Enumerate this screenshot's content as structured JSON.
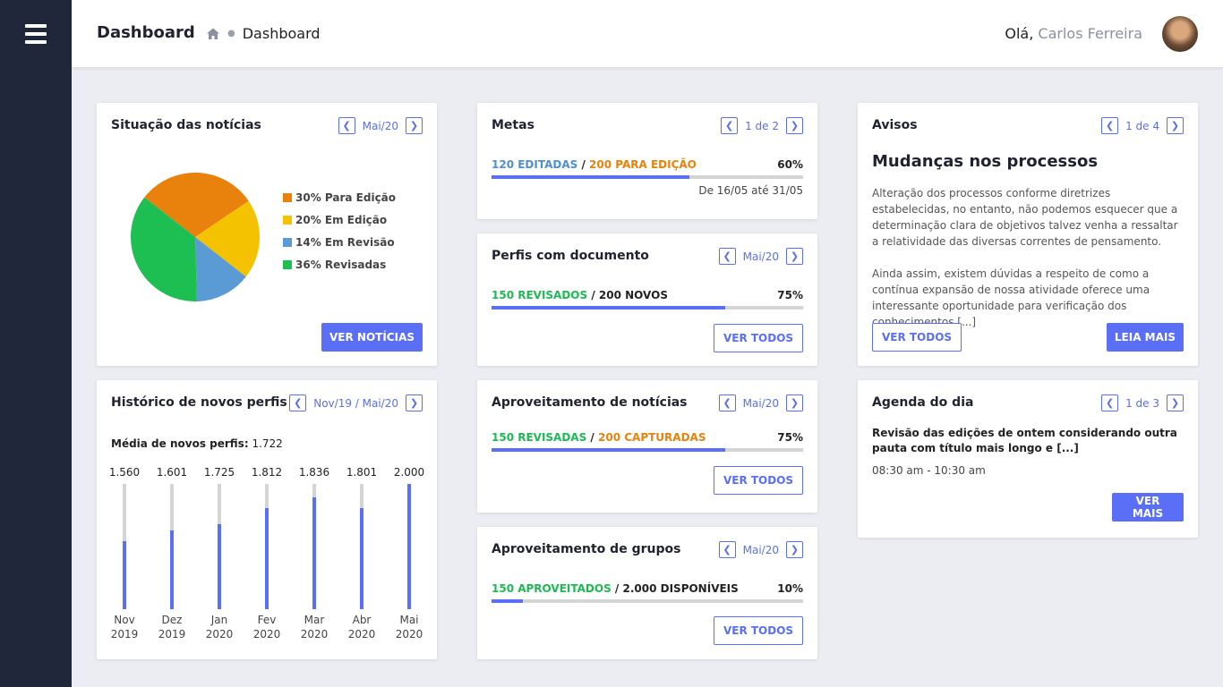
{
  "header": {
    "page_title": "Dashboard",
    "breadcrumb_current": "Dashboard",
    "greeting": "Olá,",
    "user_name": "Carlos Ferreira"
  },
  "news_status": {
    "title": "Situação das notícias",
    "pager_label": "Mai/20",
    "legend": [
      {
        "label": "30% Para Edição",
        "color": "#e8820c"
      },
      {
        "label": "20% Em Edição",
        "color": "#f5c200"
      },
      {
        "label": "14% Em Revisão",
        "color": "#5b9bd5"
      },
      {
        "label": "36% Revisadas",
        "color": "#1dbf52"
      }
    ],
    "button": "VER NOTÍCIAS"
  },
  "chart_data": [
    {
      "type": "pie",
      "title": "Situação das notícias",
      "labels": [
        "Para Edição",
        "Em Edição",
        "Em Revisão",
        "Revisadas"
      ],
      "values": [
        30,
        20,
        14,
        36
      ],
      "colors": [
        "#e8820c",
        "#f5c200",
        "#5b9bd5",
        "#1dbf52"
      ]
    },
    {
      "type": "bar",
      "title": "Histórico de novos perfis",
      "categories": [
        "Nov 2019",
        "Dez 2019",
        "Jan 2020",
        "Fev 2020",
        "Mar 2020",
        "Abr 2020",
        "Mai 2020"
      ],
      "values": [
        1560,
        1601,
        1725,
        1812,
        1836,
        1801,
        2000
      ],
      "fill_fraction": [
        0.54,
        0.63,
        0.68,
        0.81,
        0.89,
        0.81,
        1.0
      ]
    }
  ],
  "history": {
    "title": "Histórico de novos perfis",
    "pager_label": "Nov/19 / Mai/20",
    "avg_label": "Média de novos perfis:",
    "avg_value": "1.722",
    "bars": [
      {
        "value": "1.560",
        "month": "Nov",
        "year": "2019"
      },
      {
        "value": "1.601",
        "month": "Dez",
        "year": "2019"
      },
      {
        "value": "1.725",
        "month": "Jan",
        "year": "2020"
      },
      {
        "value": "1.812",
        "month": "Fev",
        "year": "2020"
      },
      {
        "value": "1.836",
        "month": "Mar",
        "year": "2020"
      },
      {
        "value": "1.801",
        "month": "Abr",
        "year": "2020"
      },
      {
        "value": "2.000",
        "month": "Mai",
        "year": "2020"
      }
    ]
  },
  "goals": {
    "title": "Metas",
    "pager_label": "1 de 2",
    "done": "120 EDITADAS",
    "sep": " / ",
    "pending": "200 PARA EDIÇÃO",
    "percent": "60%",
    "progress": 0.635,
    "date_range": "De 16/05 até 31/05"
  },
  "profiles_doc": {
    "title": "Perfis com documento",
    "pager_label": "Mai/20",
    "done": "150 REVISADOS",
    "sep": " / ",
    "total": "200 NOVOS",
    "percent": "75%",
    "progress": 0.75,
    "button": "VER TODOS"
  },
  "news_usage": {
    "title": "Aproveitamento de notícias",
    "pager_label": "Mai/20",
    "done": "150 REVISADAS",
    "sep": " / ",
    "captured": "200 CAPTURADAS",
    "percent": "75%",
    "progress": 0.75,
    "button": "VER TODOS"
  },
  "groups_usage": {
    "title": "Aproveitamento de grupos",
    "pager_label": "Mai/20",
    "done": "150 APROVEITADOS",
    "sep": " / ",
    "total": "2.000 DISPONÍVEIS",
    "percent": "10%",
    "progress": 0.1,
    "button": "VER TODOS"
  },
  "notices": {
    "title": "Avisos",
    "pager_label": "1 de 4",
    "heading": "Mudanças nos processos",
    "paragraph1": "Alteração dos processos conforme diretrizes estabelecidas, no entanto, não podemos esquecer que a determinação clara de objetivos talvez venha a ressaltar a relatividade das diversas correntes de pensamento.",
    "paragraph2": "Ainda assim, existem dúvidas a respeito de como a contínua expansão de nossa atividade oferece uma interessante oportunidade para verificação dos conhecimentos [...]",
    "button_all": "VER TODOS",
    "button_more": "LEIA MAIS"
  },
  "agenda": {
    "title": "Agenda do dia",
    "pager_label": "1 de 3",
    "event_title": "Revisão das edições de ontem considerando outra pauta com título mais longo e [...]",
    "event_time": "08:30 am - 10:30 am",
    "button": "VER MAIS"
  },
  "colors": {
    "sidebar": "#20273a",
    "accent": "#5b6ef6",
    "green": "#1fb954",
    "orange": "#e8820c",
    "blue": "#4d8fd1"
  },
  "icons": {
    "menu": "hamburger-icon",
    "home": "home-icon",
    "prev": "chevron-left-icon",
    "next": "chevron-right-icon"
  }
}
